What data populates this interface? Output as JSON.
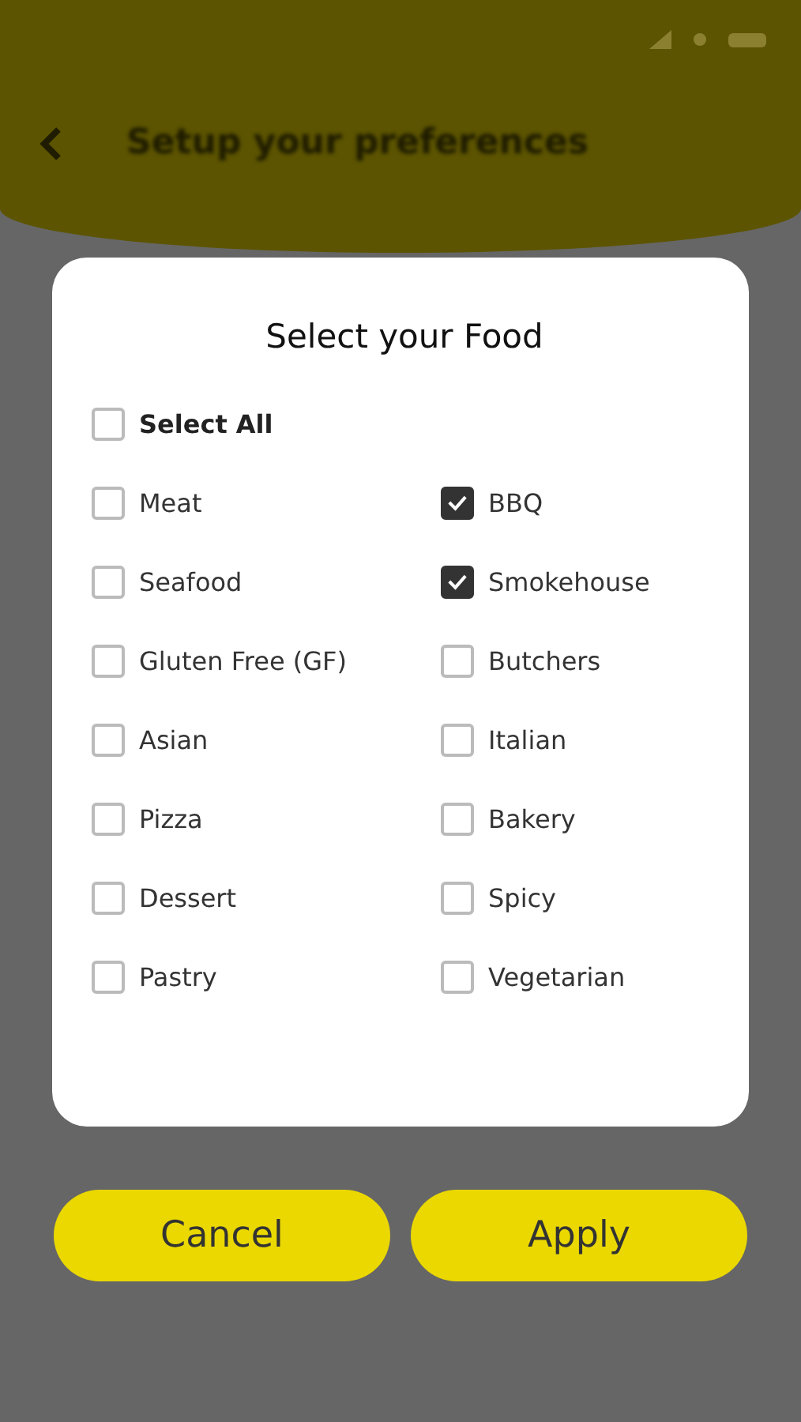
{
  "header": {
    "title": "Setup your preferences"
  },
  "dialog": {
    "title": "Select your Food",
    "select_all": {
      "label": "Select All",
      "checked": false
    },
    "options": [
      {
        "label": "Meat",
        "checked": false
      },
      {
        "label": "BBQ",
        "checked": true
      },
      {
        "label": "Seafood",
        "checked": false
      },
      {
        "label": "Smokehouse",
        "checked": true
      },
      {
        "label": "Gluten Free (GF)",
        "checked": false
      },
      {
        "label": "Butchers",
        "checked": false
      },
      {
        "label": "Asian",
        "checked": false
      },
      {
        "label": "Italian",
        "checked": false
      },
      {
        "label": "Pizza",
        "checked": false
      },
      {
        "label": "Bakery",
        "checked": false
      },
      {
        "label": "Dessert",
        "checked": false
      },
      {
        "label": "Spicy",
        "checked": false
      },
      {
        "label": "Pastry",
        "checked": false
      },
      {
        "label": "Vegetarian",
        "checked": false
      }
    ]
  },
  "buttons": [
    "Cancel",
    "Apply"
  ]
}
